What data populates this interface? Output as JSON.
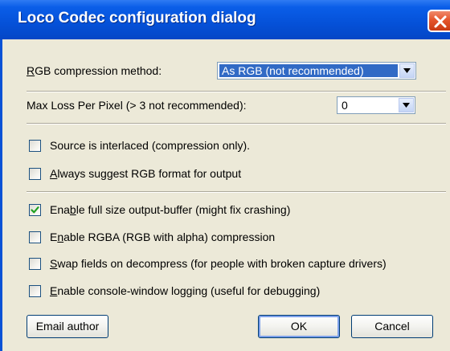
{
  "window": {
    "title": "Loco Codec configuration dialog"
  },
  "rgb_method": {
    "label_accel": "R",
    "label_rest": "GB compression method:",
    "value": "As RGB (not recommended)"
  },
  "max_loss": {
    "label": "Max Loss Per Pixel (> 3 not recommended):",
    "value": "0"
  },
  "checkboxes": {
    "interlaced": {
      "checked": false,
      "label": "Source is interlaced (compression only)."
    },
    "suggest_rgb": {
      "checked": false,
      "label_accel": "A",
      "label_rest": "lways suggest RGB format for output"
    },
    "full_buffer": {
      "checked": true,
      "label_pre": "Ena",
      "label_accel": "b",
      "label_rest": "le full size output-buffer (might fix crashing)"
    },
    "rgba": {
      "checked": false,
      "label_pre": "E",
      "label_accel": "n",
      "label_rest": "able RGBA (RGB with alpha) compression"
    },
    "swap_fields": {
      "checked": false,
      "label_accel": "S",
      "label_rest": "wap fields on decompress (for people with broken capture drivers)"
    },
    "console_log": {
      "checked": false,
      "label_accel": "E",
      "label_rest": "nable console-window logging (useful for debugging)"
    }
  },
  "buttons": {
    "email_author": "Email author",
    "ok": "OK",
    "cancel": "Cancel"
  },
  "colors": {
    "titlebar": "#0551d8",
    "client": "#ece9d8",
    "selection": "#316ac5",
    "close": "#e5562c"
  },
  "icons": {
    "close": "close-icon",
    "dropdown": "chevron-down-icon",
    "check": "checkmark-icon"
  }
}
